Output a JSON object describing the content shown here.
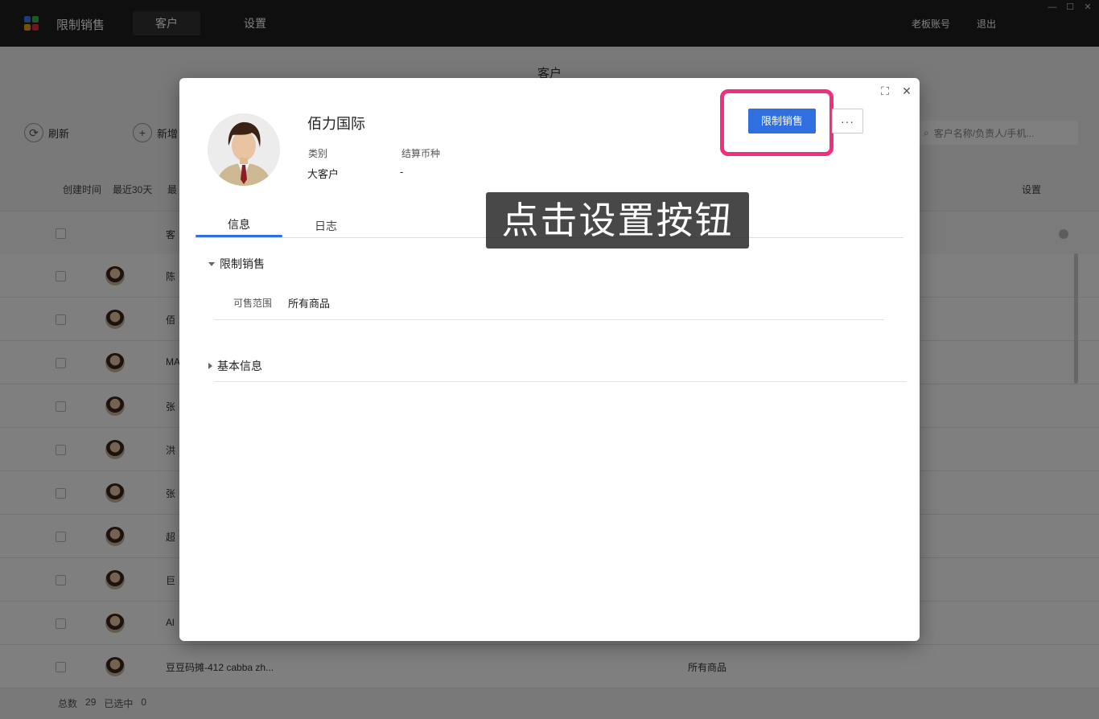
{
  "app": {
    "name": "限制销售",
    "logo_colors": [
      "#3d7bf0",
      "#37b24d",
      "#f59f00",
      "#e03131"
    ],
    "nav_tabs": [
      {
        "label": "客户",
        "active": true
      },
      {
        "label": "设置",
        "active": false
      }
    ],
    "account_label": "老板账号",
    "logout_label": "退出",
    "window_controls": [
      "minimize-icon",
      "maximize-icon",
      "close-icon"
    ]
  },
  "page": {
    "title": "客户",
    "refresh_label": "刷新",
    "add_label": "新增",
    "search_placeholder": "客户名称/负责人/手机...",
    "filter_created_label": "创建时间",
    "filter_created_value": "最近30天",
    "filter_more": "最",
    "settings_label": "设置",
    "header_col_fragment": "客",
    "rows": [
      {
        "name": "陈",
        "scope": ""
      },
      {
        "name": "佰",
        "scope": ""
      },
      {
        "name": "MA",
        "scope": ""
      },
      {
        "name": "张",
        "scope": ""
      },
      {
        "name": "洪",
        "scope": ""
      },
      {
        "name": "张",
        "scope": ""
      },
      {
        "name": "超",
        "scope": ""
      },
      {
        "name": "巨",
        "scope": ""
      },
      {
        "name": "Al",
        "scope": ""
      },
      {
        "name": "豆豆码摊-412 cabba zh...",
        "scope": "所有商品"
      }
    ],
    "total_label": "总数",
    "total_value": "29",
    "selected_label": "已选中",
    "selected_value": "0"
  },
  "modal": {
    "customer_name": "佰力国际",
    "meta": [
      {
        "label": "类别",
        "value": "大客户"
      },
      {
        "label": "结算币种",
        "value": "-"
      }
    ],
    "primary_button": "限制销售",
    "more_button": "···",
    "tabs": [
      {
        "label": "信息",
        "active": true
      },
      {
        "label": "日志",
        "active": false
      }
    ],
    "sections": {
      "restrict": {
        "title": "限制销售",
        "expanded": true,
        "field_label": "可售范围",
        "field_value": "所有商品"
      },
      "basic": {
        "title": "基本信息",
        "expanded": false
      }
    },
    "highlight_color": "#f0307c",
    "accent_color": "#2f6fe0"
  },
  "tooltip": {
    "text": "点击设置按钮"
  }
}
